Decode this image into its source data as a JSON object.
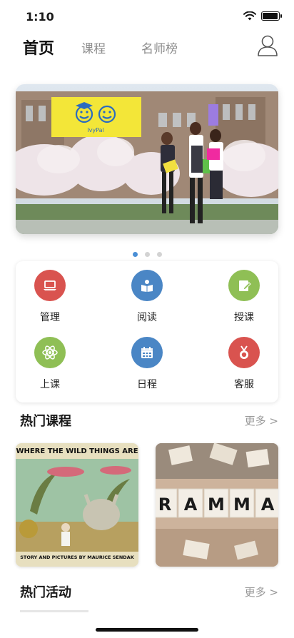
{
  "status_bar": {
    "time": "1:10",
    "icons": [
      "wifi-icon",
      "battery-icon"
    ]
  },
  "nav": {
    "tabs": [
      {
        "label": "首页",
        "active": true
      },
      {
        "label": "课程",
        "active": false
      },
      {
        "label": "名师榜",
        "active": false
      }
    ],
    "user_icon": "user-icon"
  },
  "banner": {
    "logo_text": "IvyPal",
    "slide_count": 3,
    "active_slide": 1
  },
  "functions": [
    {
      "label": "管理",
      "icon": "laptop-icon",
      "color": "#d9534f"
    },
    {
      "label": "阅读",
      "icon": "reader-icon",
      "color": "#4a86c5"
    },
    {
      "label": "授课",
      "icon": "edit-note-icon",
      "color": "#8fbf55"
    },
    {
      "label": "上课",
      "icon": "atom-icon",
      "color": "#8fbf55"
    },
    {
      "label": "日程",
      "icon": "calendar-icon",
      "color": "#4a86c5"
    },
    {
      "label": "客服",
      "icon": "medal-icon",
      "color": "#d9534f"
    }
  ],
  "hot_courses": {
    "title": "热门课程",
    "more": "更多  >",
    "items": [
      {
        "top_text": "WHERE THE WILD THINGS ARE",
        "bottom_text": "STORY AND PICTURES BY MAURICE SENDAK"
      },
      {
        "letters": [
          "R",
          "A",
          "M",
          "M",
          "A"
        ]
      }
    ]
  },
  "hot_activities": {
    "title": "热门活动",
    "more": "更多  >"
  },
  "colors": {
    "accent": "#4a8fd6",
    "dot_inactive": "#d3d3d3",
    "logo_bg": "#f3e638"
  }
}
